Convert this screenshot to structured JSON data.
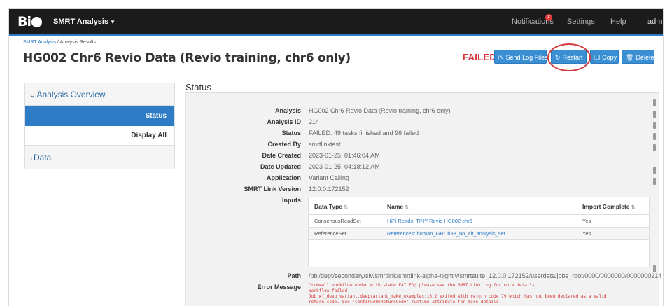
{
  "navbar": {
    "app_menu": "SMRT Analysis",
    "notifications": "Notifications",
    "notifications_count": "2",
    "settings": "Settings",
    "help": "Help",
    "user": "admin"
  },
  "breadcrumb": {
    "root": "SMRT Analysis",
    "separator": "/",
    "current": "Analysis Results"
  },
  "page": {
    "title": "HG002 Chr6 Revio Data (Revio training, chr6 only)"
  },
  "actions": {
    "status_label": "FAILED",
    "send_log": "Send Log Files",
    "restart": "Restart",
    "copy": "Copy",
    "delete": "Delete"
  },
  "sidebar": {
    "analysis_overview": "Analysis Overview",
    "status": "Status",
    "display_all": "Display All",
    "data": "Data"
  },
  "status": {
    "heading": "Status",
    "fields": [
      {
        "label": "Analysis",
        "value": "HG002 Chr6 Revio Data (Revio training, chr6 only)"
      },
      {
        "label": "Analysis ID",
        "value": "214"
      },
      {
        "label": "Status",
        "value": "FAILED: 49 tasks finished and 96 failed"
      },
      {
        "label": "Created By",
        "value": "smrtlinktest"
      },
      {
        "label": "Date Created",
        "value": "2023-01-25, 01:46:04 AM"
      },
      {
        "label": "Date Updated",
        "value": "2023-01-25, 04:18:12 AM"
      },
      {
        "label": "Application",
        "value": "Variant Calling"
      },
      {
        "label": "SMRT Link Version",
        "value": "12.0.0.172152"
      }
    ],
    "inputs_label": "Inputs",
    "inputs_table": {
      "headers": [
        "Data Type",
        "Name",
        "Import Complete"
      ],
      "rows": [
        [
          "ConsensusReadSet",
          "HiFi Reads: TINY Revio HG002 chr6",
          "Yes"
        ],
        [
          "ReferenceSet",
          "References: human_GRCh38_no_alt_analysis_set",
          "Yes"
        ]
      ]
    },
    "path_label": "Path",
    "path_value": "/pbi/dept/secondary/siv/smrtlink/smrtlink-alpha-nightly/smrtsuite_12.0.0.172152/userdata/jobs_root/0000/0000000/0000000214",
    "error_label": "Error Message",
    "error_text": "Cromwell workflow ended with state FAILED; please see the SMRT Link Log for more details\nWorkflow failed\nJob wf_deep_variant.deepvariant_make_examples:13:2 exited with return code 79 which has not been declared as a valid\nreturn code. See 'continueOnReturnCode' runtime attribute for more details."
  },
  "colors": {
    "navbar_bg": "#1b1b1b",
    "accent": "#2e7cc5",
    "failed": "#d9343b",
    "button": "#3a8fd4"
  }
}
